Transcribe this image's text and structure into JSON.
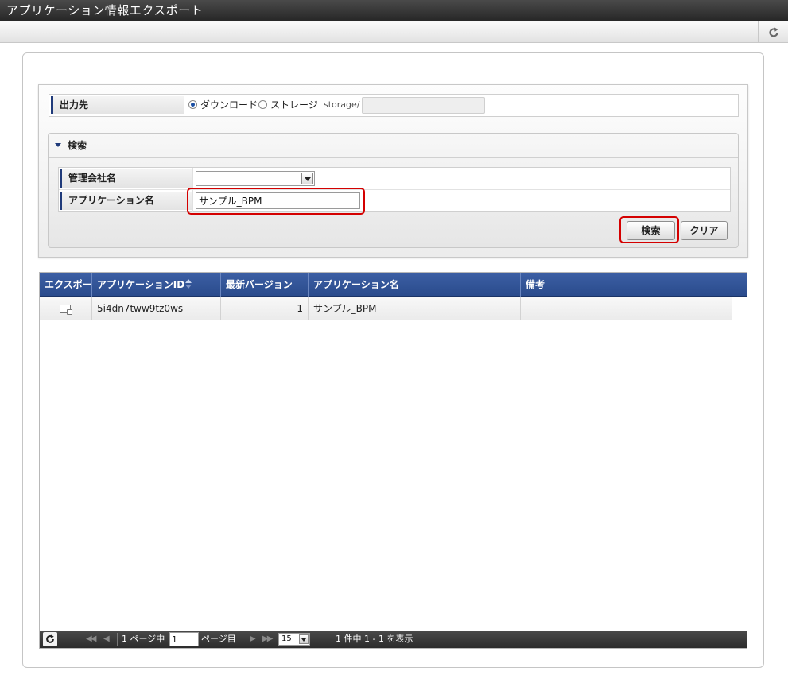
{
  "window": {
    "title": "アプリケーション情報エクスポート"
  },
  "toolbar": {
    "refresh_icon": "refresh-icon"
  },
  "output": {
    "label": "出力先",
    "options": [
      "ダウンロード",
      "ストレージ"
    ],
    "selected": "ダウンロード",
    "storage_prefix": "storage/",
    "storage_value": ""
  },
  "search": {
    "header": "検索",
    "fields": [
      {
        "label": "管理会社名",
        "value": ""
      },
      {
        "label": "アプリケーション名",
        "value": "サンプル_BPM"
      }
    ],
    "search_button": "検索",
    "clear_button": "クリア"
  },
  "grid": {
    "columns": [
      "エクスポート",
      "アプリケーションID",
      "最新バージョン",
      "アプリケーション名",
      "備考"
    ],
    "rows": [
      {
        "id": "5i4dn7tww9tz0ws",
        "version": "1",
        "name": "サンプル_BPM",
        "note": ""
      }
    ]
  },
  "pager": {
    "page_prefix": "1 ページ中",
    "page_value": "1",
    "page_suffix": "ページ目",
    "page_size": "15",
    "summary": "1 件中 1 - 1 を表示"
  },
  "colors": {
    "header_blue": "#2e4f92",
    "highlight_red": "#d40000",
    "title_bar": "#333333"
  }
}
